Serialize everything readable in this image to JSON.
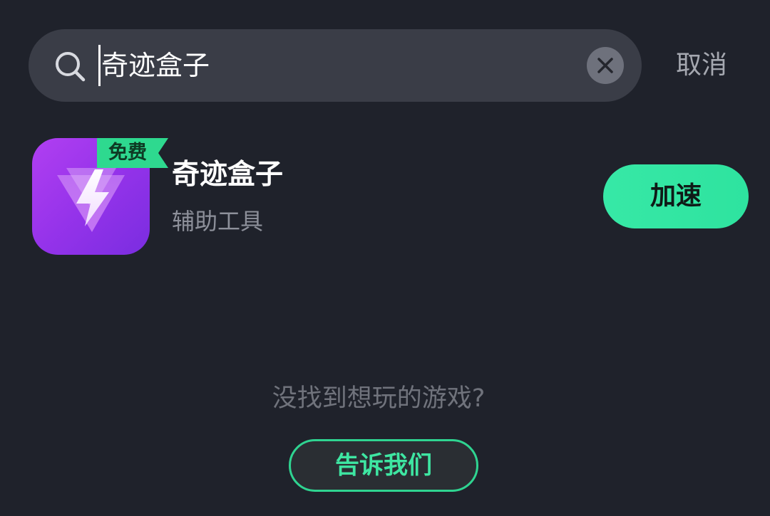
{
  "search": {
    "query": "奇迹盒子",
    "cancel_label": "取消",
    "search_icon": "search-icon",
    "clear_icon": "close-icon"
  },
  "result": {
    "badge": "免费",
    "name": "奇迹盒子",
    "category": "辅助工具",
    "action_label": "加速",
    "icon": "lightning-bolt-app-icon",
    "colors": {
      "icon_gradient_start": "#b13ff1",
      "icon_gradient_end": "#7a2de0",
      "badge_bg": "#2ed98f",
      "action_bg": "#37e8a6"
    }
  },
  "footer": {
    "prompt": "没找到想玩的游戏?",
    "feedback_label": "告诉我们",
    "accent_color": "#2fd491"
  },
  "theme": {
    "background": "#1f222b",
    "search_bg": "#3a3d47"
  }
}
